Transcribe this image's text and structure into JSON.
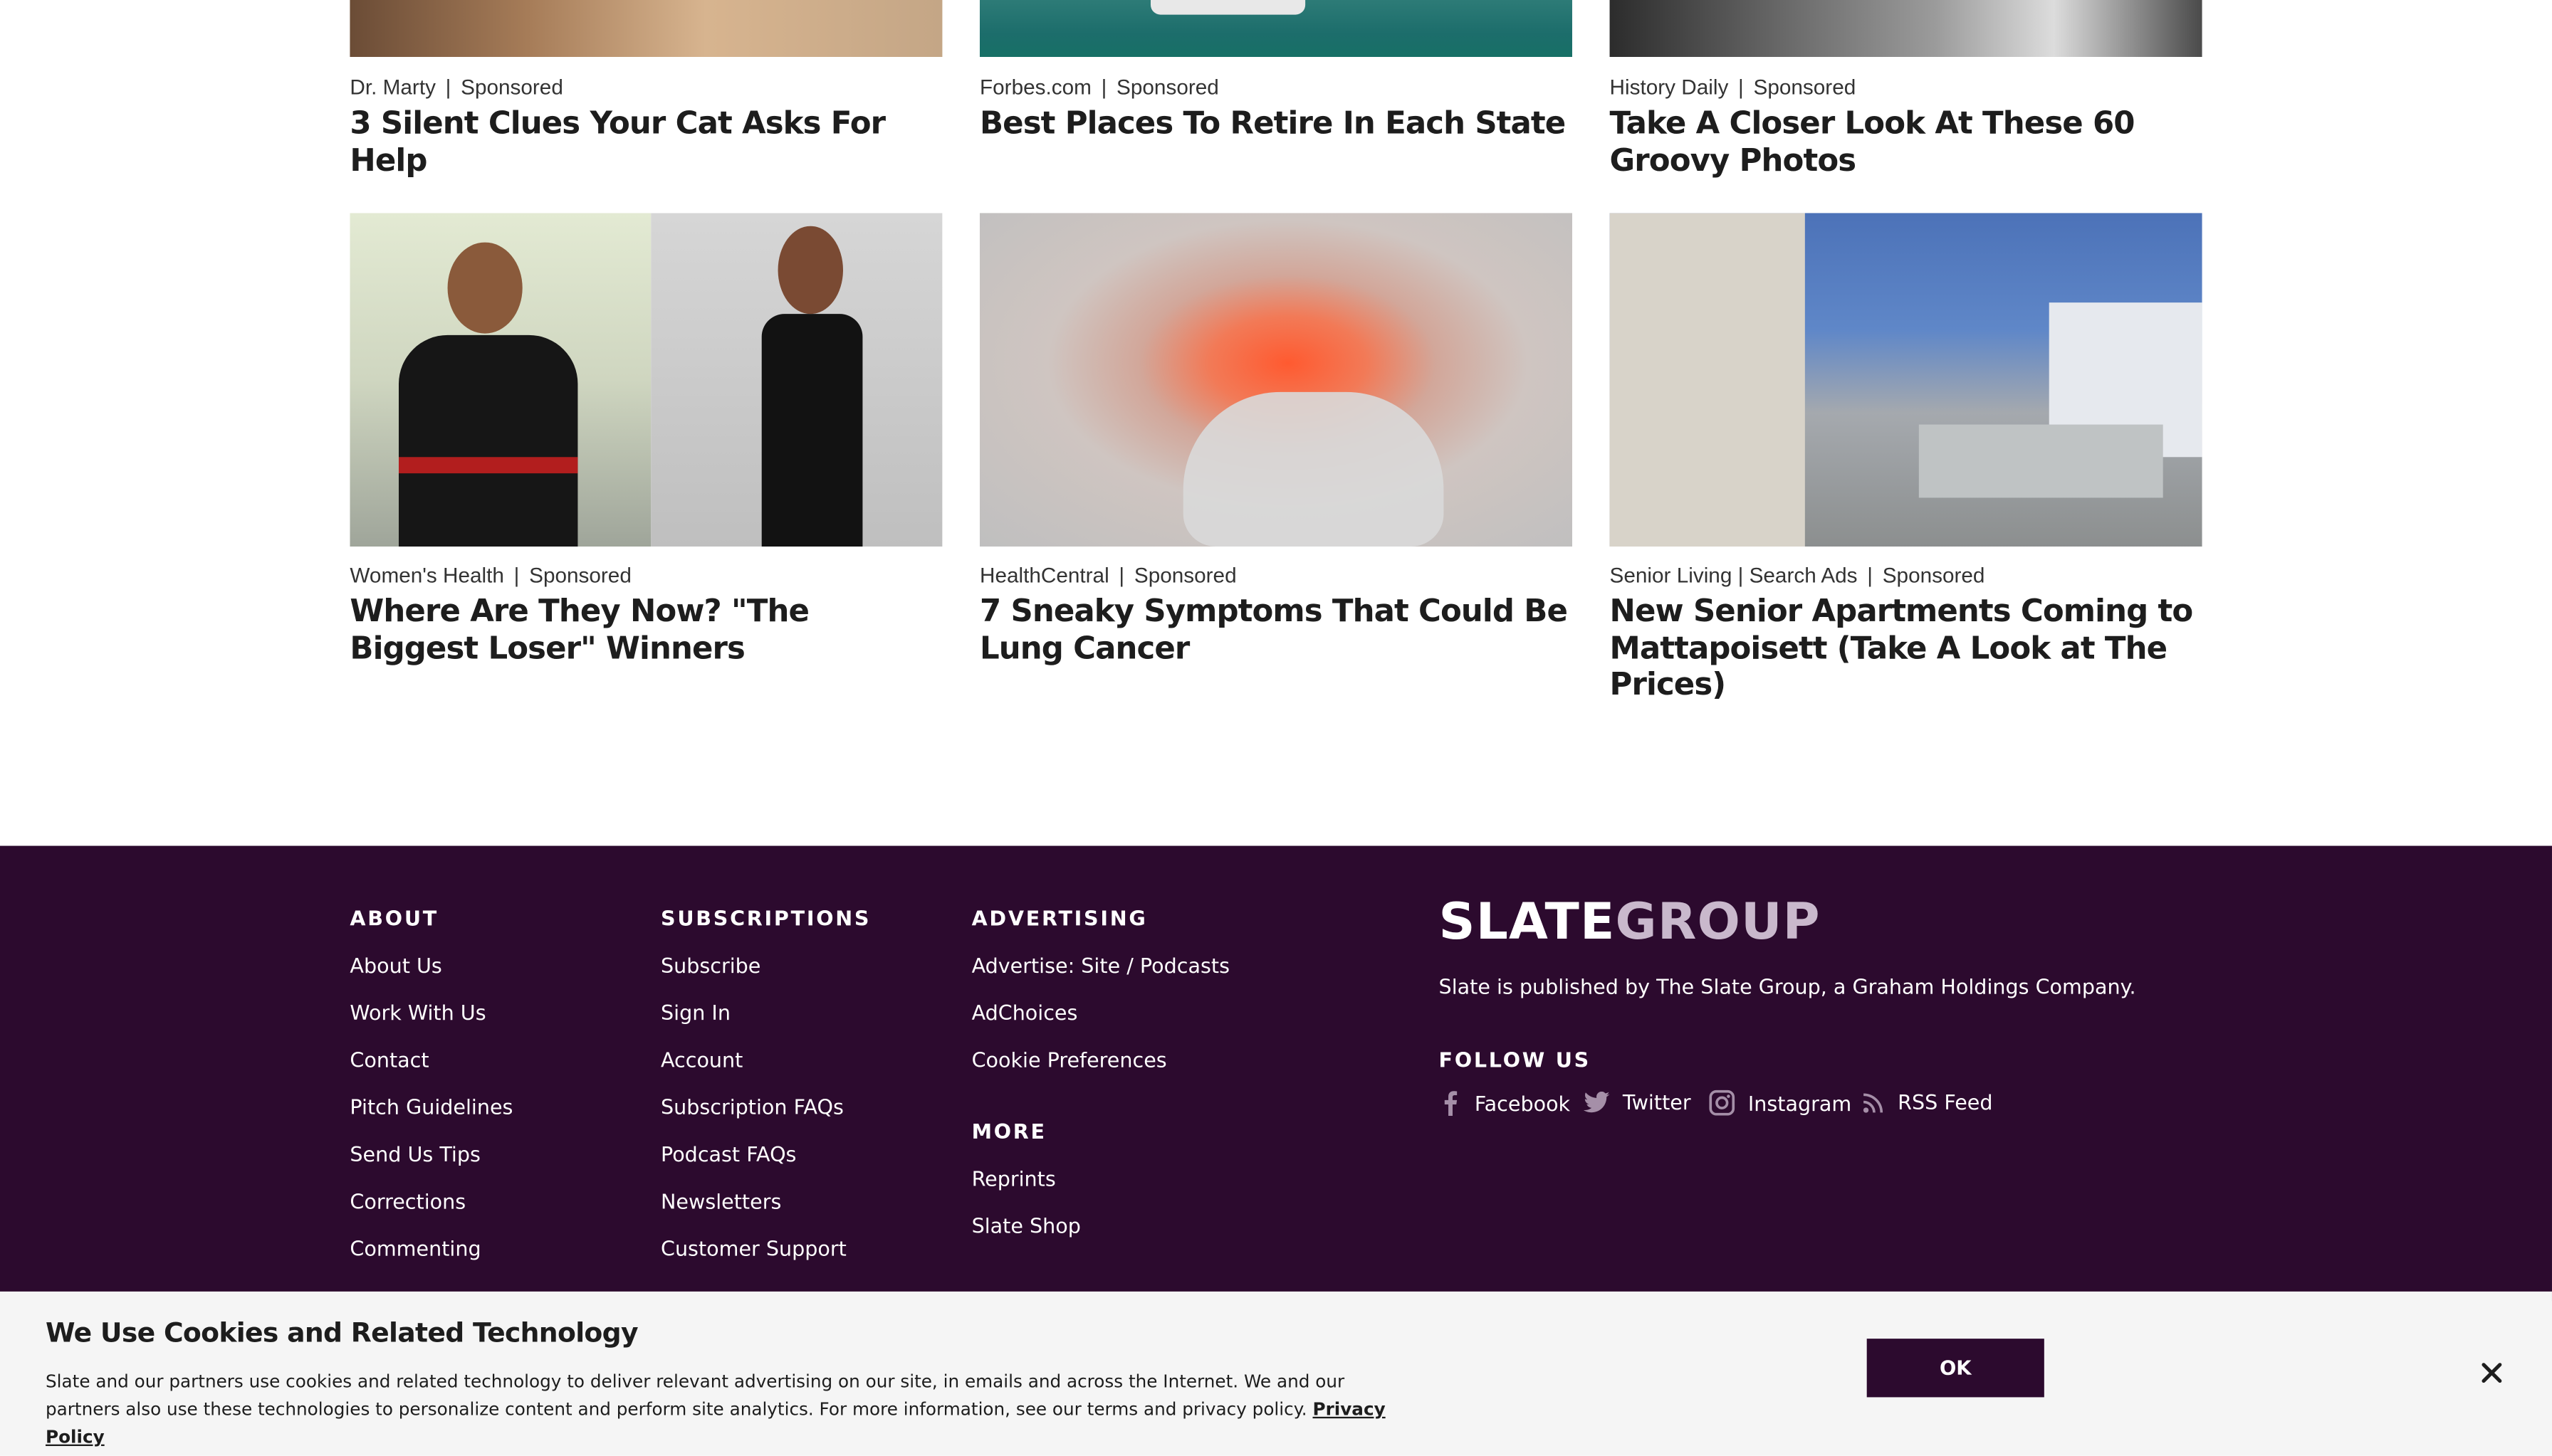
{
  "sponsored": [
    {
      "source": "Dr. Marty",
      "label": "Sponsored",
      "headline": "3 Silent Clues Your Cat Asks For Help"
    },
    {
      "source": "Forbes.com",
      "label": "Sponsored",
      "headline": "Best Places To Retire In Each State"
    },
    {
      "source": "History Daily",
      "label": "Sponsored",
      "headline": "Take A Closer Look At These 60 Groovy Photos"
    },
    {
      "source": "Women's Health",
      "label": "Sponsored",
      "headline": "Where Are They Now? \"The Biggest Loser\" Winners"
    },
    {
      "source": "HealthCentral",
      "label": "Sponsored",
      "headline": "7 Sneaky Symptoms That Could Be Lung Cancer"
    },
    {
      "source": "Senior Living | Search Ads",
      "label": "Sponsored",
      "headline": "New Senior Apartments Coming to Mattapoisett (Take A Look at The Prices)"
    }
  ],
  "footer": {
    "about": {
      "heading": "ABOUT",
      "links": [
        "About Us",
        "Work With Us",
        "Contact",
        "Pitch Guidelines",
        "Send Us Tips",
        "Corrections",
        "Commenting"
      ]
    },
    "subscriptions": {
      "heading": "SUBSCRIPTIONS",
      "links": [
        "Subscribe",
        "Sign In",
        "Account",
        "Subscription FAQs",
        "Podcast FAQs",
        "Newsletters",
        "Customer Support"
      ]
    },
    "advertising": {
      "heading": "ADVERTISING",
      "links": [
        "Advertise: Site / Podcasts",
        "AdChoices",
        "Cookie Preferences"
      ]
    },
    "more": {
      "heading": "MORE",
      "links": [
        "Reprints",
        "Slate Shop"
      ]
    },
    "logo_part1": "SLATE",
    "logo_part2": "GROUP",
    "publisher_text": "Slate is published by The Slate Group, a Graham Holdings Company.",
    "follow_heading": "FOLLOW US",
    "social": [
      {
        "label": "Facebook",
        "icon": "facebook-icon"
      },
      {
        "label": "Twitter",
        "icon": "twitter-icon"
      },
      {
        "label": "Instagram",
        "icon": "instagram-icon"
      },
      {
        "label": "RSS Feed",
        "icon": "rss-icon"
      }
    ],
    "background_color": "#2c0a2e"
  },
  "cookie": {
    "title": "We Use Cookies and Related Technology",
    "text": "Slate and our partners use cookies and related technology to deliver relevant advertising on our site, in emails and across the Internet. We and our partners also use these technologies to personalize content and perform site analytics. For more information, see our terms and privacy policy.",
    "privacy_link": "Privacy Policy",
    "ok_label": "OK"
  }
}
